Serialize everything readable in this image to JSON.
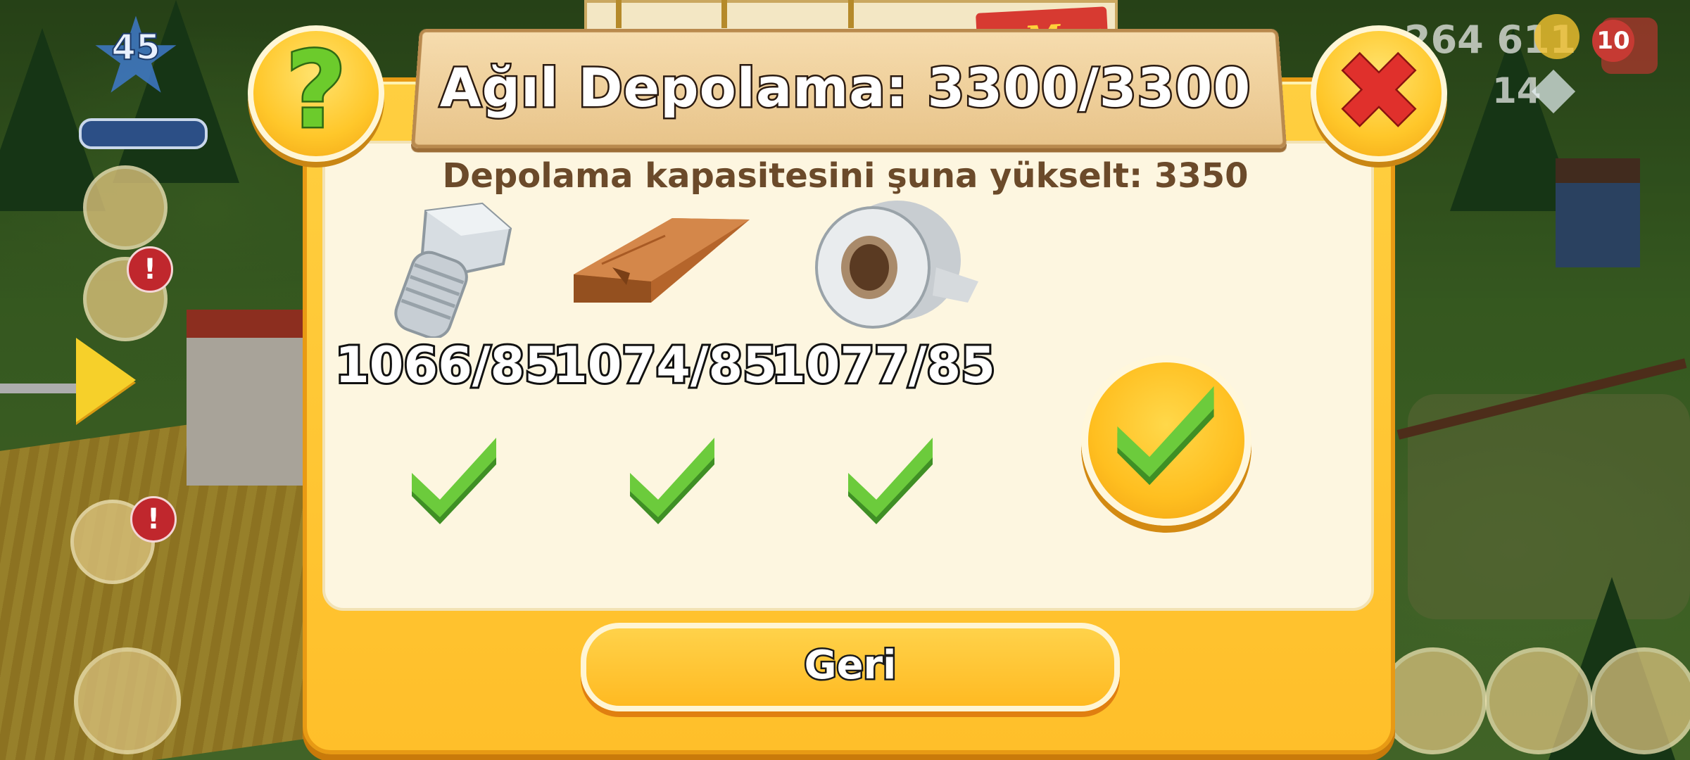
{
  "hud": {
    "level": "45",
    "coins": "264 611",
    "diamonds": "14",
    "gift_count": "10",
    "alert_mark": "!"
  },
  "dialog": {
    "tag": "Max",
    "title": "Ağıl Depolama: 3300/3300",
    "subtitle": "Depolama kapasitesini şuna yükselt: 3350",
    "help_glyph": "?",
    "close_glyph": "✖",
    "items": [
      {
        "icon": "bolt-icon",
        "count": "1066/85"
      },
      {
        "icon": "plank-icon",
        "count": "1074/85"
      },
      {
        "icon": "duct-tape-icon",
        "count": "1077/85"
      }
    ],
    "back_label": "Geri"
  },
  "colors": {
    "dialog_gold": "#ffc72a",
    "panel_cream": "#fdf6e0",
    "check_green": "#5cb83a",
    "close_red": "#e0302c",
    "text_brown": "#6b4a2a"
  }
}
